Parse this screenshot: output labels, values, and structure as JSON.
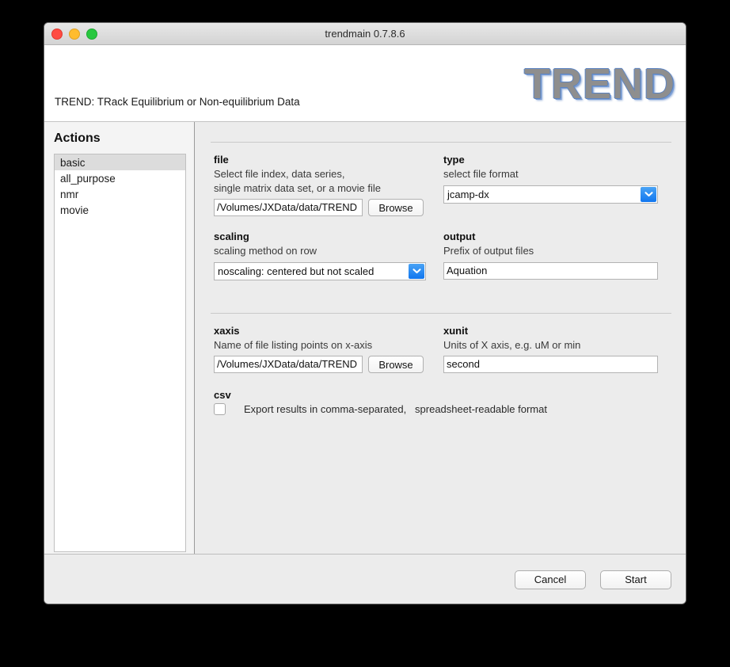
{
  "window": {
    "title": "trendmain 0.7.8.6",
    "traffic_lights": [
      "close",
      "minimize",
      "maximize"
    ]
  },
  "header": {
    "subtitle": "TREND: TRack Equilibrium or Non-equilibrium Data",
    "logo_text": "TREND",
    "logo_color": "#8e8e8e",
    "logo_outline_color": "#5b84c4"
  },
  "sidebar": {
    "heading": "Actions",
    "items": [
      {
        "label": "basic",
        "selected": true
      },
      {
        "label": "all_purpose",
        "selected": false
      },
      {
        "label": "nmr",
        "selected": false
      },
      {
        "label": "movie",
        "selected": false
      }
    ]
  },
  "main": {
    "fields": {
      "file": {
        "label": "file",
        "help": "Select file index, data series,\nsingle matrix data set, or a movie file",
        "value": "/Volumes/JXData/data/TREND",
        "browse_label": "Browse"
      },
      "type": {
        "label": "type",
        "help": "select file format",
        "value": "jcamp-dx"
      },
      "scaling": {
        "label": "scaling",
        "help": "scaling method on row",
        "value": "noscaling: centered but not scaled"
      },
      "output": {
        "label": "output",
        "help": "Prefix of output files",
        "value": "Aquation"
      },
      "xaxis": {
        "label": "xaxis",
        "help": "Name of file listing points on x-axis",
        "value": "/Volumes/JXData/data/TREND",
        "browse_label": "Browse"
      },
      "xunit": {
        "label": "xunit",
        "help": "Units of X axis, e.g. uM or min",
        "value": "second"
      },
      "csv": {
        "label": "csv",
        "caption": "Export results in comma-separated,   spreadsheet-readable format",
        "checked": false
      }
    }
  },
  "footer": {
    "cancel_label": "Cancel",
    "start_label": "Start"
  },
  "colors": {
    "accent_blue": "#1076ef",
    "window_bg": "#ececec",
    "sidebar_bg": "#f4f4f4",
    "selection_gray": "#dcdcdc"
  }
}
